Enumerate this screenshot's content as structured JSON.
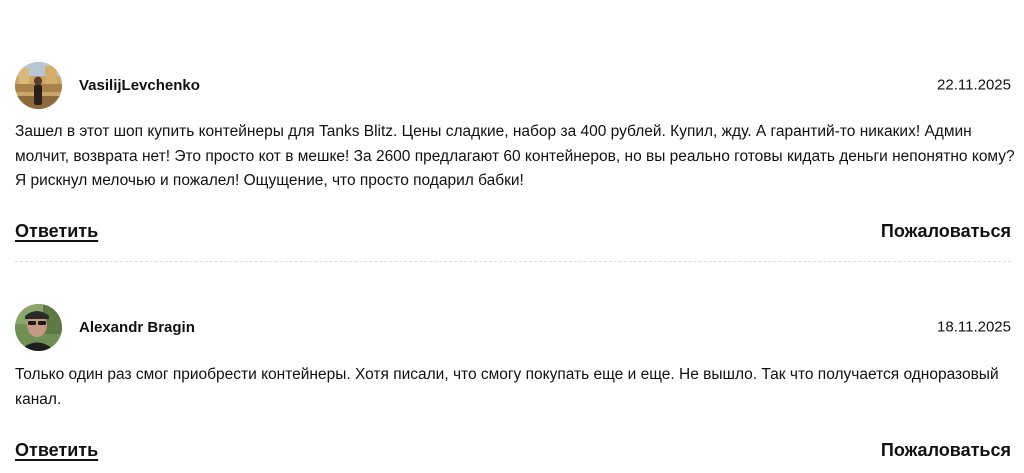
{
  "comments": [
    {
      "author": "VasilijLevchenko",
      "date": "22.11.2025",
      "avatar_icon": "user-avatar-photo",
      "text": "Зашел в этот шоп купить контейнеры для Tanks Blitz. Цены сладкие, набор за 400 рублей. Купил, жду. А гарантий-то никаких! Админ молчит, возврата нет! Это просто кот в мешке! За 2600 предлагают 60 контейнеров, но вы реально готовы кидать деньги непонятно кому? Я рискнул мелочью и пожалел! Ощущение, что просто подарил бабки!",
      "reply_label": "Ответить",
      "report_label": "Пожаловаться"
    },
    {
      "author": "Alexandr Bragin",
      "date": "18.11.2025",
      "avatar_icon": "user-avatar-photo",
      "text": "Только один раз смог приобрести контейнеры. Хотя писали, что смогу покупать еще и еще. Не вышло. Так что получается одноразовый канал.",
      "reply_label": "Ответить",
      "report_label": "Пожаловаться"
    }
  ],
  "colors": {
    "text": "#111111",
    "divider": "#dddddd",
    "background": "#ffffff"
  }
}
